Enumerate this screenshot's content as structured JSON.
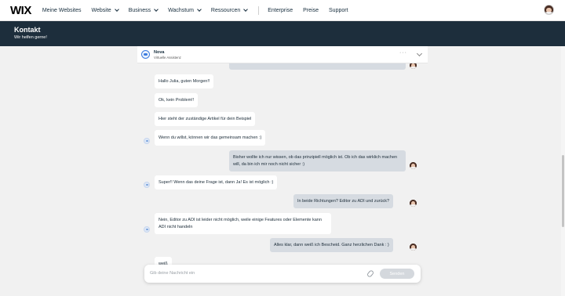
{
  "nav": {
    "logo": "WIX",
    "items": [
      {
        "label": "Meine Websites",
        "chevron": false
      },
      {
        "label": "Website",
        "chevron": true
      },
      {
        "label": "Business",
        "chevron": true
      },
      {
        "label": "Wachstum",
        "chevron": true
      },
      {
        "label": "Ressourcen",
        "chevron": true
      }
    ],
    "items_right": [
      {
        "label": "Enterprise"
      },
      {
        "label": "Preise"
      },
      {
        "label": "Support"
      }
    ]
  },
  "header": {
    "title": "Kontakt",
    "subtitle": "Wir helfen gerne!"
  },
  "chat_header": {
    "bot_name": "Nova",
    "bot_subtitle": "Virtuelle Assistenz",
    "menu_icon": "more-dots-icon",
    "collapse_icon": "chevron-down-icon"
  },
  "messages": [
    {
      "from": "user",
      "text": ""
    },
    {
      "from": "bot",
      "text": "Hallo Julia, guten Morgen!!"
    },
    {
      "from": "bot",
      "text": "Ok, kein Problem!!"
    },
    {
      "from": "bot",
      "text": "Hier steht der zuständige Artikel für dein Beispiel"
    },
    {
      "from": "bot",
      "text": "Wenn du willst, können wir das gemeinsam machen :)"
    },
    {
      "from": "user",
      "text": "Bisher wollte ich nur wissen, ob das prinzipiell möglich ist. Ob ich das wirklich machen will, da bin ich mir noch nicht sicher :)"
    },
    {
      "from": "bot",
      "text": "Super!! Wenn das deine Frage ist, dann Ja! Es ist möglich :)"
    },
    {
      "from": "user",
      "text": "In beide Richtungen? Editor zu ADI und zurück?"
    },
    {
      "from": "bot",
      "text": "Nein, Editor zu ADI ist leider nicht möglich, weile einige Features oder Elemente kann ADI nicht handeln"
    },
    {
      "from": "user",
      "text": "Alles klar, dann weiß ich Bescheid. Ganz herzlichen Dank : )"
    },
    {
      "from": "bot",
      "text": "weiß"
    }
  ],
  "input": {
    "placeholder": "Gib deine Nachricht ein",
    "send_label": "Senden",
    "attach_icon": "paperclip-icon"
  },
  "colors": {
    "band": "#1d2e3c",
    "user_bubble": "#d6dbe1",
    "bot_bubble": "#ffffff",
    "page_bg": "#f1f1f1"
  }
}
